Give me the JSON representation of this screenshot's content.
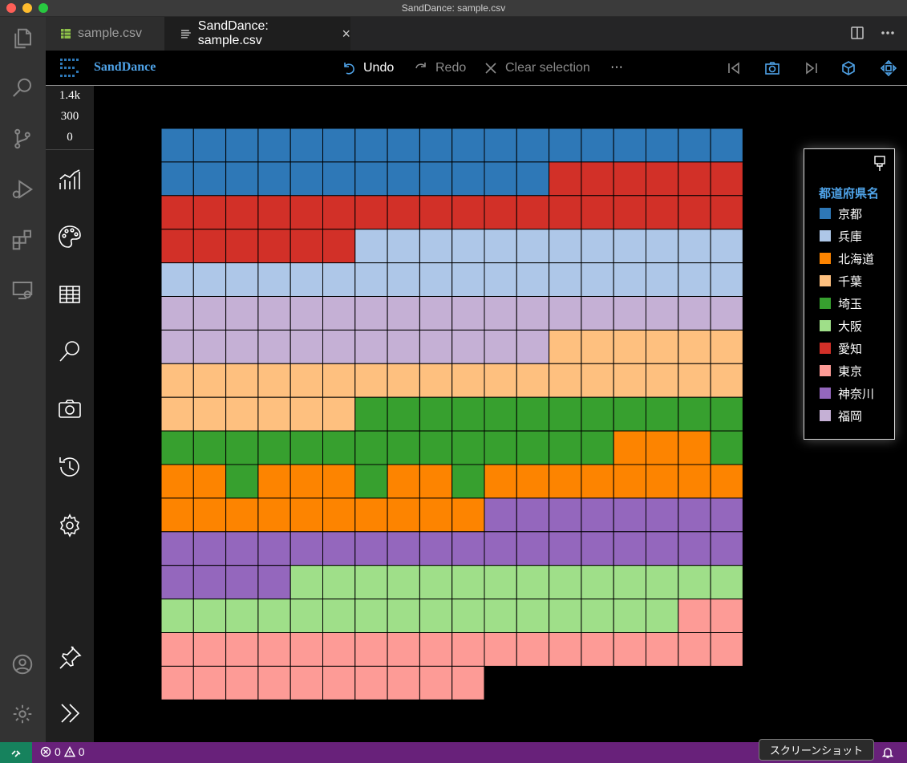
{
  "window": {
    "title": "SandDance: sample.csv"
  },
  "tabs": [
    {
      "label": "sample.csv",
      "icon": "table-file-icon",
      "active": false
    },
    {
      "label": "SandDance: sample.csv",
      "icon": "lines-file-icon",
      "active": true,
      "close": "×"
    }
  ],
  "sanddance": {
    "brand": "SandDance",
    "undo_label": "Undo",
    "redo_label": "Redo",
    "clear_label": "Clear selection",
    "more_label": "···"
  },
  "side": {
    "counts": [
      "1.4k",
      "300",
      "0"
    ]
  },
  "legend": {
    "title": "都道府県名",
    "items": [
      {
        "label": "京都",
        "color": "#2e78b7"
      },
      {
        "label": "兵庫",
        "color": "#aec7e8"
      },
      {
        "label": "北海道",
        "color": "#fd8400"
      },
      {
        "label": "千葉",
        "color": "#fec07f"
      },
      {
        "label": "埼玉",
        "color": "#37a02f"
      },
      {
        "label": "大阪",
        "color": "#9fdf89"
      },
      {
        "label": "愛知",
        "color": "#d23028"
      },
      {
        "label": "東京",
        "color": "#fd9b96"
      },
      {
        "label": "神奈川",
        "color": "#9467bd"
      },
      {
        "label": "福岡",
        "color": "#c5b0d5"
      }
    ]
  },
  "status": {
    "errors": "0",
    "warnings": "0",
    "tooltip": "スクリーンショット"
  },
  "chart_data": {
    "type": "table",
    "columns": 18,
    "cells_order": "row-major from top-left",
    "runs": [
      {
        "category": "京都",
        "color": "#2e78b7",
        "count": 30
      },
      {
        "category": "愛知",
        "color": "#d23028",
        "count": 30
      },
      {
        "category": "兵庫",
        "color": "#aec7e8",
        "count": 30
      },
      {
        "category": "福岡",
        "color": "#c5b0d5",
        "count": 30
      },
      {
        "category": "千葉",
        "color": "#fec07f",
        "count": 30
      },
      {
        "category": "埼玉",
        "color": "#37a02f",
        "count": 26
      },
      {
        "category": "北海道",
        "color": "#fd8400",
        "count": 3
      },
      {
        "category": "埼玉",
        "color": "#37a02f",
        "count": 1
      },
      {
        "category": "北海道",
        "color": "#fd8400",
        "count": 2
      },
      {
        "category": "埼玉",
        "color": "#37a02f",
        "count": 1
      },
      {
        "category": "北海道",
        "color": "#fd8400",
        "count": 3
      },
      {
        "category": "埼玉",
        "color": "#37a02f",
        "count": 1
      },
      {
        "category": "北海道",
        "color": "#fd8400",
        "count": 2
      },
      {
        "category": "埼玉",
        "color": "#37a02f",
        "count": 1
      },
      {
        "category": "北海道",
        "color": "#fd8400",
        "count": 18
      },
      {
        "category": "神奈川",
        "color": "#9467bd",
        "count": 30
      },
      {
        "category": "大阪",
        "color": "#9fdf89",
        "count": 30
      },
      {
        "category": "東京",
        "color": "#fd9b96",
        "count": 30
      }
    ]
  }
}
